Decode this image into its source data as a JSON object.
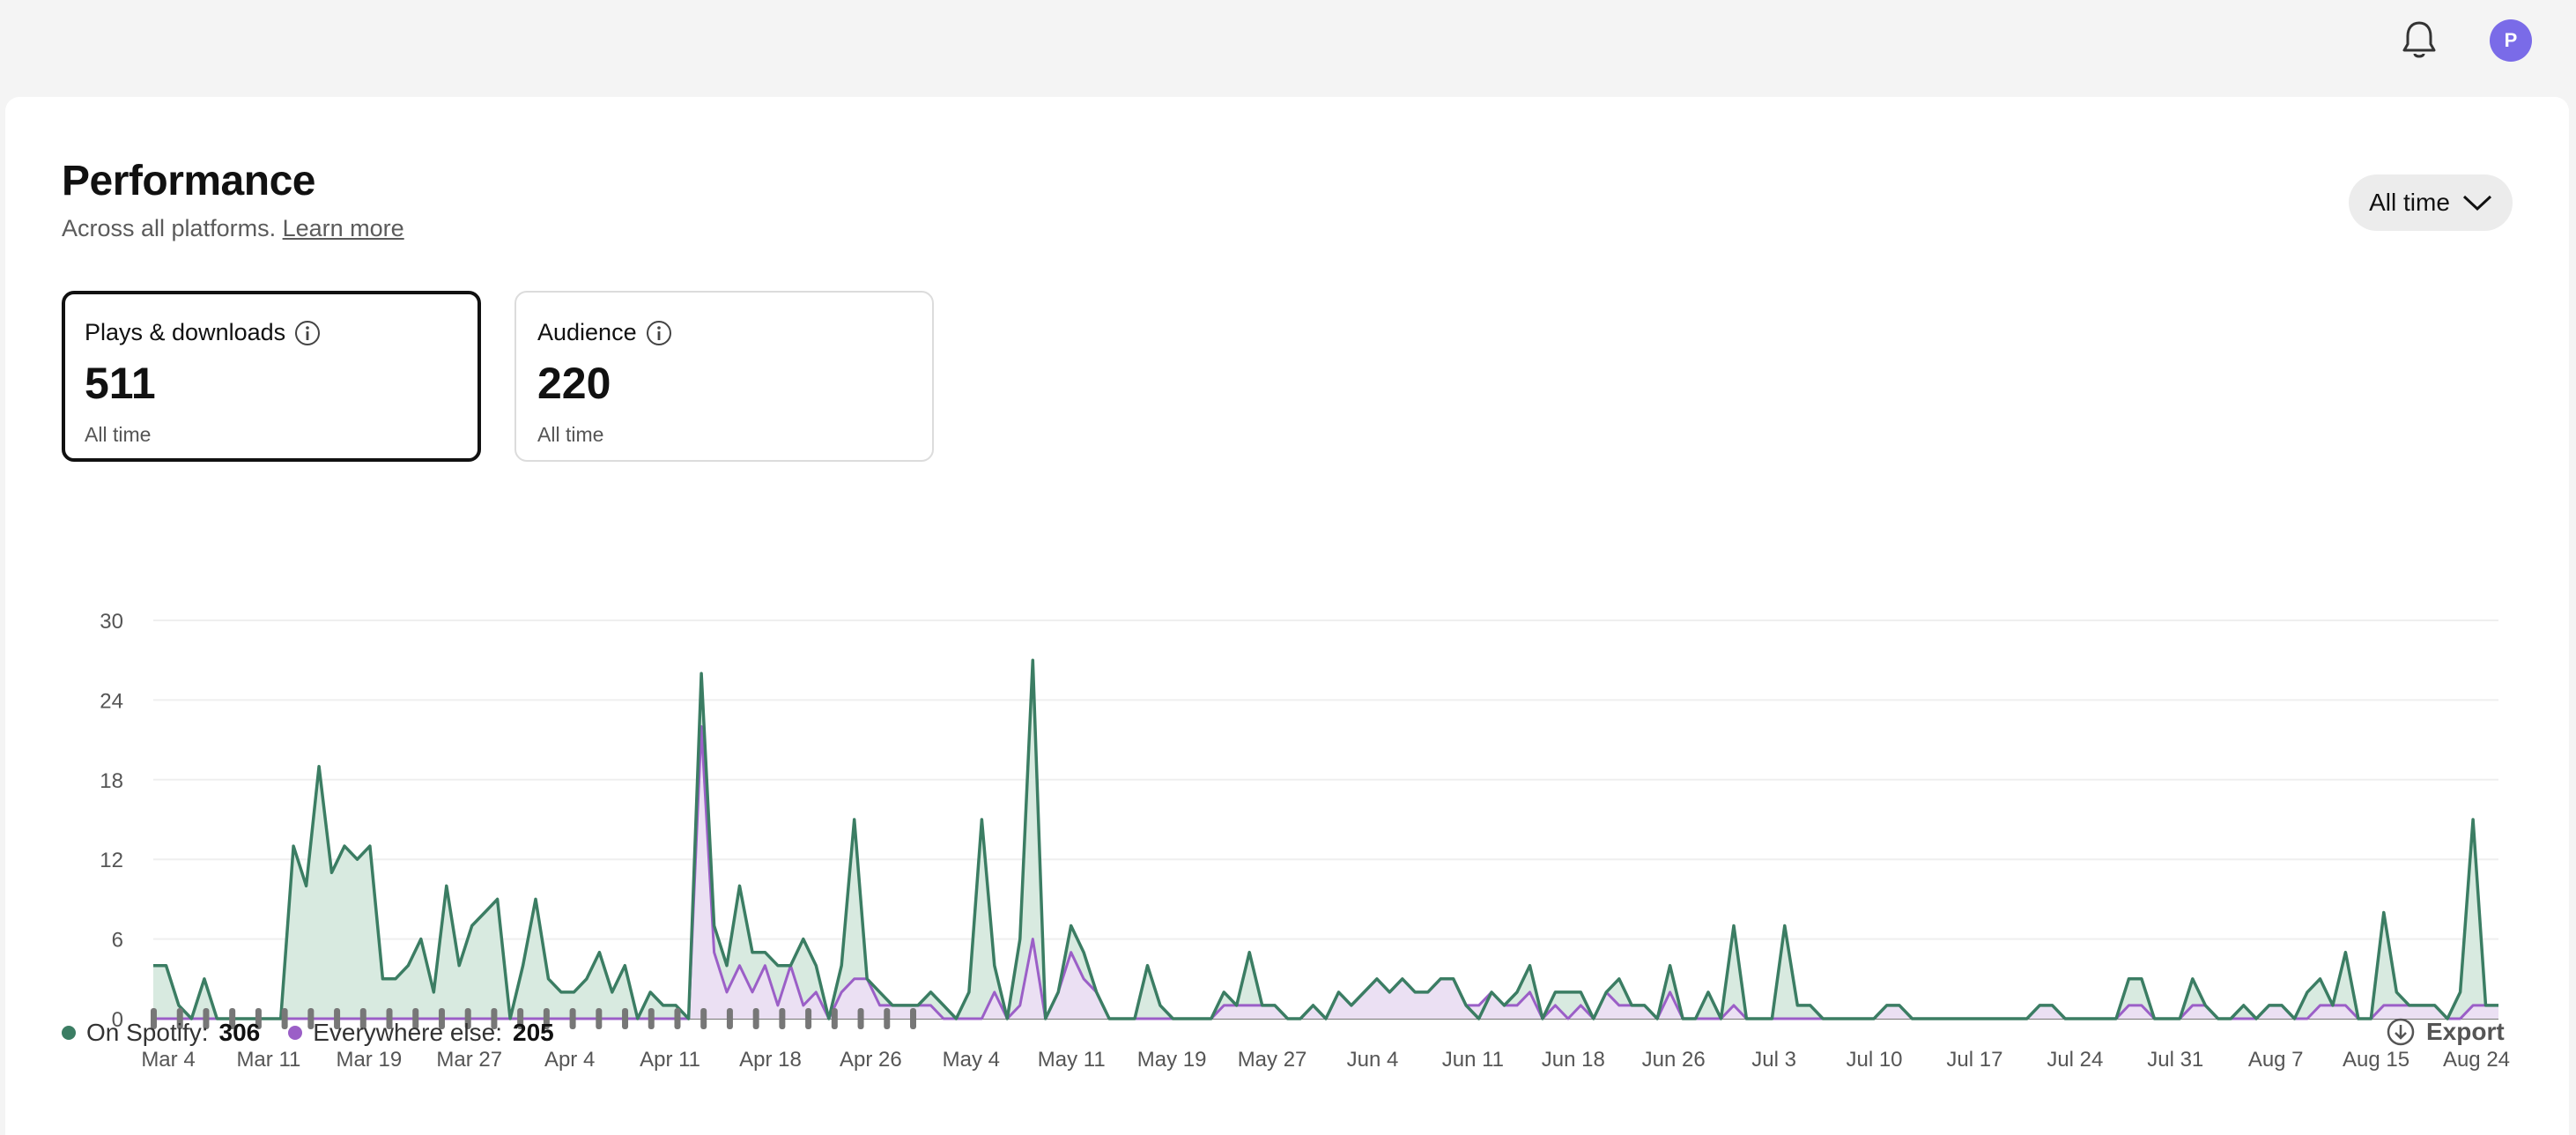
{
  "topbar": {
    "icons": [
      "bell-icon"
    ],
    "avatar_initial": "P"
  },
  "header": {
    "title": "Performance",
    "subtitle": "Across all platforms.",
    "learn_more": "Learn more",
    "range_label": "All time"
  },
  "metrics": [
    {
      "label": "Plays & downloads",
      "value": "511",
      "sub": "All time"
    },
    {
      "label": "Audience",
      "value": "220",
      "sub": "All time"
    }
  ],
  "legend": {
    "spotify_label": "On Spotify:",
    "spotify_value": "306",
    "else_label": "Everywhere else:",
    "else_value": "205"
  },
  "export_label": "Export",
  "colors": {
    "spotify": "#3b7d63",
    "spotify_fill": "#d6e9de",
    "else": "#9b5fc7",
    "else_fill": "#ecdff3",
    "accent": "#7a6be8"
  },
  "chart_data": {
    "type": "area",
    "ylim": [
      0,
      30
    ],
    "yticks": [
      0,
      6,
      12,
      18,
      24,
      30
    ],
    "xtick_labels": [
      "Mar 4",
      "Mar 11",
      "Mar 19",
      "Mar 27",
      "Apr 4",
      "Apr 11",
      "Apr 18",
      "Apr 26",
      "May 4",
      "May 11",
      "May 19",
      "May 27",
      "Jun 4",
      "Jun 11",
      "Jun 18",
      "Jun 26",
      "Jul 3",
      "Jul 10",
      "Jul 17",
      "Jul 24",
      "Jul 31",
      "Aug 7",
      "Aug 15",
      "Aug 24"
    ],
    "series": [
      {
        "name": "On Spotify",
        "values": [
          4,
          4,
          1,
          0,
          3,
          0,
          0,
          0,
          0,
          0,
          0,
          13,
          10,
          19,
          11,
          13,
          12,
          13,
          3,
          3,
          4,
          6,
          2,
          10,
          4,
          7,
          8,
          9,
          0,
          4,
          9,
          3,
          2,
          2,
          3,
          5,
          2,
          4,
          0,
          2,
          1,
          1,
          0,
          26,
          7,
          4,
          10,
          5,
          5,
          4,
          4,
          6,
          4,
          0,
          4,
          15,
          3,
          2,
          1,
          1,
          1,
          2,
          1,
          0,
          2,
          15,
          4,
          0,
          6,
          27,
          0,
          2,
          7,
          5,
          2,
          0,
          0,
          0,
          4,
          1,
          0,
          0,
          0,
          0,
          2,
          1,
          5,
          1,
          1,
          0,
          0,
          1,
          0,
          2,
          1,
          2,
          3,
          2,
          3,
          2,
          2,
          3,
          3,
          1,
          0,
          2,
          1,
          2,
          4,
          0,
          2,
          2,
          2,
          0,
          2,
          3,
          1,
          1,
          0,
          4,
          0,
          0,
          2,
          0,
          7,
          0,
          0,
          0,
          7,
          1,
          1,
          0,
          0,
          0,
          0,
          0,
          1,
          1,
          0,
          0,
          0,
          0,
          0,
          0,
          0,
          0,
          0,
          0,
          1,
          1,
          0,
          0,
          0,
          0,
          0,
          3,
          3,
          0,
          0,
          0,
          3,
          1,
          0,
          0,
          1,
          0,
          1,
          1,
          0,
          2,
          3,
          1,
          5,
          0,
          0,
          8,
          2,
          1,
          1,
          1,
          0,
          2,
          15,
          1,
          1
        ]
      },
      {
        "name": "Everywhere else",
        "values": [
          0,
          0,
          0,
          0,
          0,
          0,
          0,
          0,
          0,
          0,
          0,
          0,
          0,
          0,
          0,
          0,
          0,
          0,
          0,
          0,
          0,
          0,
          0,
          0,
          0,
          0,
          0,
          0,
          0,
          0,
          0,
          0,
          0,
          0,
          0,
          0,
          0,
          0,
          0,
          0,
          0,
          0,
          0,
          22,
          5,
          2,
          4,
          2,
          4,
          1,
          4,
          1,
          2,
          0,
          2,
          3,
          3,
          1,
          1,
          1,
          1,
          1,
          0,
          0,
          0,
          0,
          2,
          0,
          1,
          6,
          0,
          2,
          5,
          3,
          2,
          0,
          0,
          0,
          0,
          0,
          0,
          0,
          0,
          0,
          1,
          1,
          1,
          1,
          1,
          0,
          0,
          1,
          0,
          2,
          1,
          2,
          3,
          2,
          3,
          2,
          2,
          3,
          3,
          1,
          1,
          2,
          1,
          1,
          2,
          0,
          1,
          0,
          1,
          0,
          2,
          1,
          1,
          1,
          0,
          2,
          0,
          0,
          0,
          0,
          1,
          0,
          0,
          0,
          0,
          0,
          0,
          0,
          0,
          0,
          0,
          0,
          1,
          1,
          0,
          0,
          0,
          0,
          0,
          0,
          0,
          0,
          0,
          0,
          1,
          1,
          0,
          0,
          0,
          0,
          0,
          1,
          1,
          0,
          0,
          0,
          1,
          1,
          0,
          0,
          0,
          0,
          1,
          1,
          0,
          0,
          1,
          1,
          1,
          0,
          0,
          1,
          1,
          1,
          1,
          1,
          0,
          0,
          1,
          1,
          1
        ]
      }
    ],
    "markers_count": 30,
    "grid": true,
    "legend_position": "bottom-left"
  }
}
